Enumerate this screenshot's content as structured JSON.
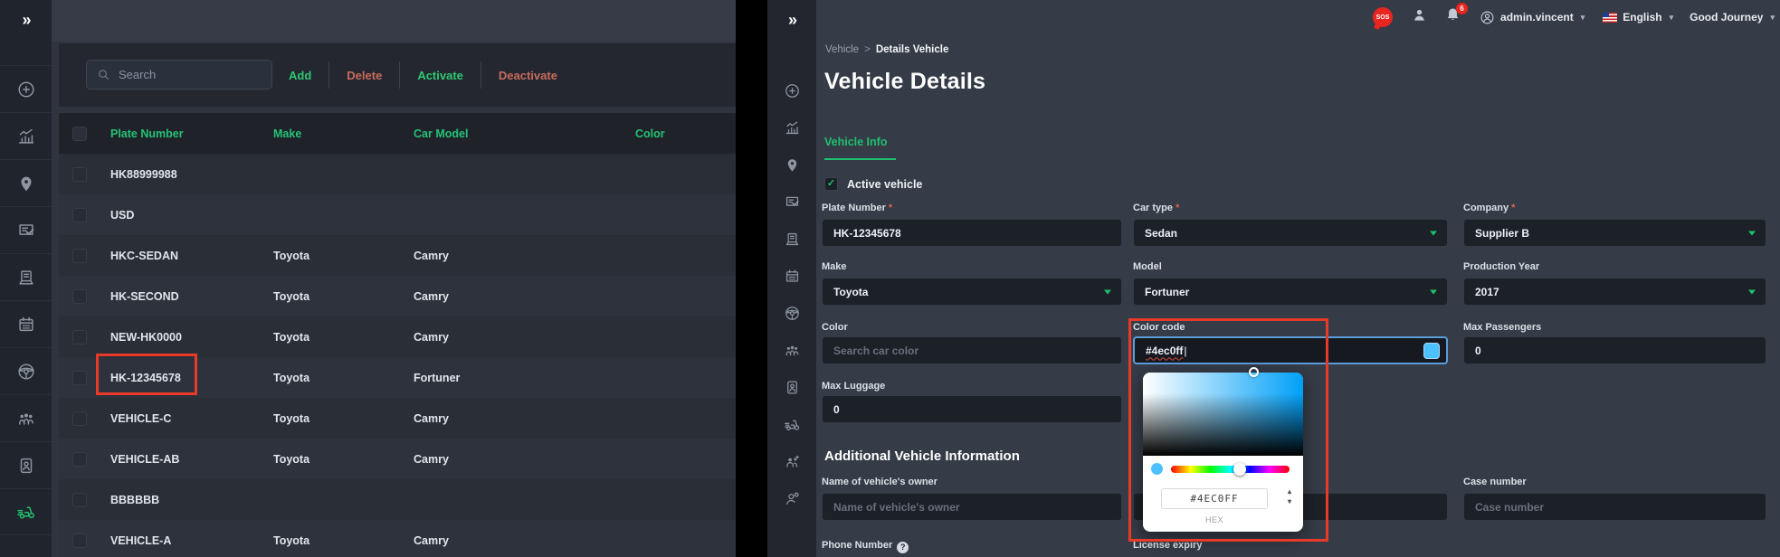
{
  "colors": {
    "accent_green": "#1ec16f",
    "table_header_green": "#25c377",
    "annotation_red": "#e83a28",
    "action_add": "#2ec973",
    "action_delete": "#c96c5d",
    "action_activate": "#2ec973",
    "action_deactivate": "#c96c5d",
    "color_swatch": "#4dc0ff",
    "focus_border": "#5c9cd8"
  },
  "left_sidebar": {
    "expand_icon": "double-chevron-right",
    "icons": [
      "target-icon",
      "analytics-icon",
      "location-icon",
      "survey-icon",
      "receipt-icon",
      "calendar-icon",
      "steering-wheel-icon",
      "passengers-icon",
      "contact-card-icon",
      "vehicle-scooter-icon"
    ]
  },
  "mini_sidebar": {
    "expand_icon": "double-chevron-right",
    "icons": [
      "target-icon",
      "analytics-icon",
      "location-icon",
      "survey-icon",
      "receipt-icon",
      "calendar-icon",
      "steering-wheel-icon",
      "passengers-icon",
      "contact-card-icon",
      "vehicle-scooter-icon",
      "team-icon",
      "person-add-icon"
    ]
  },
  "left_panel": {
    "search": {
      "placeholder": "Search"
    },
    "actions": {
      "add": "Add",
      "delete": "Delete",
      "activate": "Activate",
      "deactivate": "Deactivate"
    },
    "table": {
      "columns": {
        "plate": "Plate Number",
        "make": "Make",
        "model": "Car Model",
        "color": "Color"
      },
      "rows": [
        {
          "plate": "HK88999988",
          "make": "",
          "model": "",
          "color": ""
        },
        {
          "plate": "USD",
          "make": "",
          "model": "",
          "color": ""
        },
        {
          "plate": "HKC-SEDAN",
          "make": "Toyota",
          "model": "Camry",
          "color": ""
        },
        {
          "plate": "HK-SECOND",
          "make": "Toyota",
          "model": "Camry",
          "color": ""
        },
        {
          "plate": "NEW-HK0000",
          "make": "Toyota",
          "model": "Camry",
          "color": ""
        },
        {
          "plate": "HK-12345678",
          "make": "Toyota",
          "model": "Fortuner",
          "color": ""
        },
        {
          "plate": "VEHICLE-C",
          "make": "Toyota",
          "model": "Camry",
          "color": ""
        },
        {
          "plate": "VEHICLE-AB",
          "make": "Toyota",
          "model": "Camry",
          "color": ""
        },
        {
          "plate": "BBBBBB",
          "make": "",
          "model": "",
          "color": ""
        },
        {
          "plate": "VEHICLE-A",
          "make": "Toyota",
          "model": "Camry",
          "color": ""
        }
      ]
    }
  },
  "header": {
    "sos_label": "SOS",
    "notification_count": "6",
    "username": "admin.vincent",
    "language": "English",
    "org_name": "Good Journey"
  },
  "breadcrumb": {
    "parent": "Vehicle",
    "separator": ">",
    "current": "Details Vehicle"
  },
  "main": {
    "title": "Vehicle Details",
    "tab_label": "Vehicle Info",
    "active_checkbox_label": "Active vehicle",
    "check_glyph": "✓",
    "section_title": "Additional Vehicle Information",
    "fields": {
      "plate_number": {
        "label": "Plate Number",
        "required": "*",
        "value": "HK-12345678"
      },
      "car_type": {
        "label": "Car type",
        "required": "*",
        "value": "Sedan"
      },
      "company": {
        "label": "Company",
        "required": "*",
        "value": "Supplier B"
      },
      "make": {
        "label": "Make",
        "value": "Toyota"
      },
      "model": {
        "label": "Model",
        "value": "Fortuner"
      },
      "production_year": {
        "label": "Production Year",
        "value": "2017"
      },
      "color": {
        "label": "Color",
        "placeholder": "Search car color"
      },
      "color_code": {
        "label": "Color code",
        "value": "#4ec0ff"
      },
      "max_passengers": {
        "label": "Max Passengers",
        "value": "0"
      },
      "max_luggage": {
        "label": "Max Luggage",
        "value": "0"
      },
      "owner_name": {
        "label": "Name of vehicle's owner",
        "placeholder": "Name of vehicle's owner"
      },
      "case_number": {
        "label": "Case number",
        "placeholder": "Case number"
      },
      "phone_number": {
        "label": "Phone Number",
        "help": "?"
      },
      "license_expiry": {
        "label": "License expiry"
      }
    }
  },
  "color_picker": {
    "hex_value": "#4EC0FF",
    "format_label": "HEX",
    "current_color": "#4dc0ff"
  }
}
